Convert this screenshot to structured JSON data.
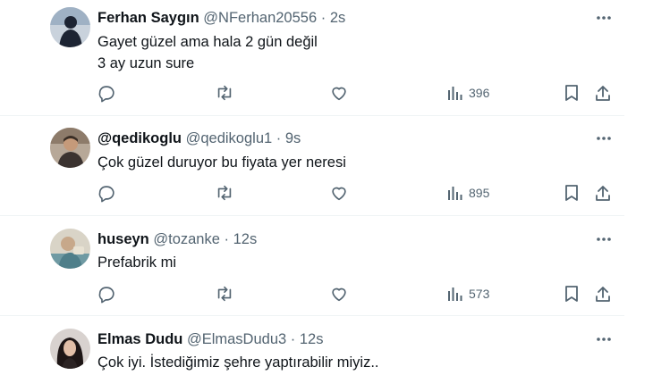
{
  "tweets": [
    {
      "name": "Ferhan Saygın",
      "handle": "@NFerhan20556",
      "dot": "·",
      "time": "2s",
      "text": "Gayet güzel ama hala 2 gün değil\n3 ay uzun sure",
      "views": "396",
      "avatar_color": "#2b3a55"
    },
    {
      "name": "@qedikoglu",
      "handle": "@qedikoglu1",
      "dot": "·",
      "time": "9s",
      "text": "Çok güzel duruyor bu fiyata yer neresi",
      "views": "895",
      "avatar_color": "#5c4a3d"
    },
    {
      "name": "huseyn",
      "handle": "@tozanke",
      "dot": "·",
      "time": "12s",
      "text": "Prefabrik mi",
      "views": "573",
      "avatar_color": "#7fa7b0"
    },
    {
      "name": "Elmas Dudu",
      "handle": "@ElmasDudu3",
      "dot": "·",
      "time": "12s",
      "text": "Çok iyi. İstediğimiz şehre yaptırabilir miyiz..",
      "views": "",
      "avatar_color": "#2a2020"
    }
  ],
  "icons": {
    "reply": "reply-icon",
    "retweet": "retweet-icon",
    "like": "heart-icon",
    "views": "views-chart-icon",
    "bookmark": "bookmark-icon",
    "share": "share-icon",
    "more": "more-icon"
  },
  "colors": {
    "text": "#0f1419",
    "secondary": "#536471",
    "divider": "#eff3f4"
  }
}
